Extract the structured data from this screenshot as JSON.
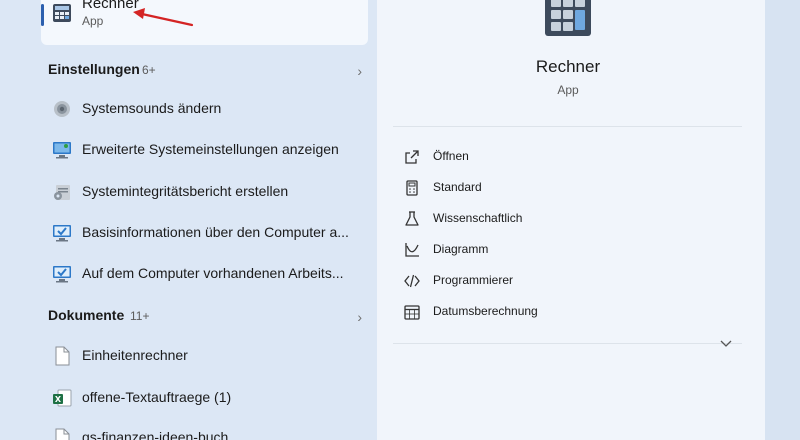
{
  "best_match": {
    "title": "Rechner",
    "subtitle": "App"
  },
  "settings_section": {
    "label": "Einstellungen",
    "count": "6+",
    "items": [
      {
        "label": "Systemsounds ändern",
        "icon": "speaker-icon"
      },
      {
        "label": "Erweiterte Systemeinstellungen anzeigen",
        "icon": "monitor-settings-icon"
      },
      {
        "label": "Systemintegritätsbericht erstellen",
        "icon": "gear-report-icon"
      },
      {
        "label": "Basisinformationen über den Computer a...",
        "icon": "monitor-check-icon"
      },
      {
        "label": "Auf dem Computer vorhandenen Arbeits...",
        "icon": "monitor-check-icon"
      }
    ]
  },
  "documents_section": {
    "label": "Dokumente",
    "count": "11+",
    "items": [
      {
        "label": "Einheitenrechner",
        "icon": "document-icon"
      },
      {
        "label": "offene-Textauftraege (1)",
        "icon": "excel-file-icon"
      },
      {
        "label": "gs-finanzen-ideen-buch",
        "icon": "document-icon"
      }
    ]
  },
  "details": {
    "app_name": "Rechner",
    "app_type": "App",
    "actions": [
      {
        "label": "Öffnen",
        "icon": "open-external-icon"
      },
      {
        "label": "Standard",
        "icon": "calculator-icon"
      },
      {
        "label": "Wissenschaftlich",
        "icon": "flask-icon"
      },
      {
        "label": "Diagramm",
        "icon": "graph-icon"
      },
      {
        "label": "Programmierer",
        "icon": "code-icon"
      },
      {
        "label": "Datumsberechnung",
        "icon": "calendar-icon"
      }
    ]
  },
  "colors": {
    "accent": "#2b5fae",
    "annotation_arrow": "#d42424",
    "left_panel_bg": "#dce7f5",
    "right_panel_bg": "#f1f5fb"
  }
}
